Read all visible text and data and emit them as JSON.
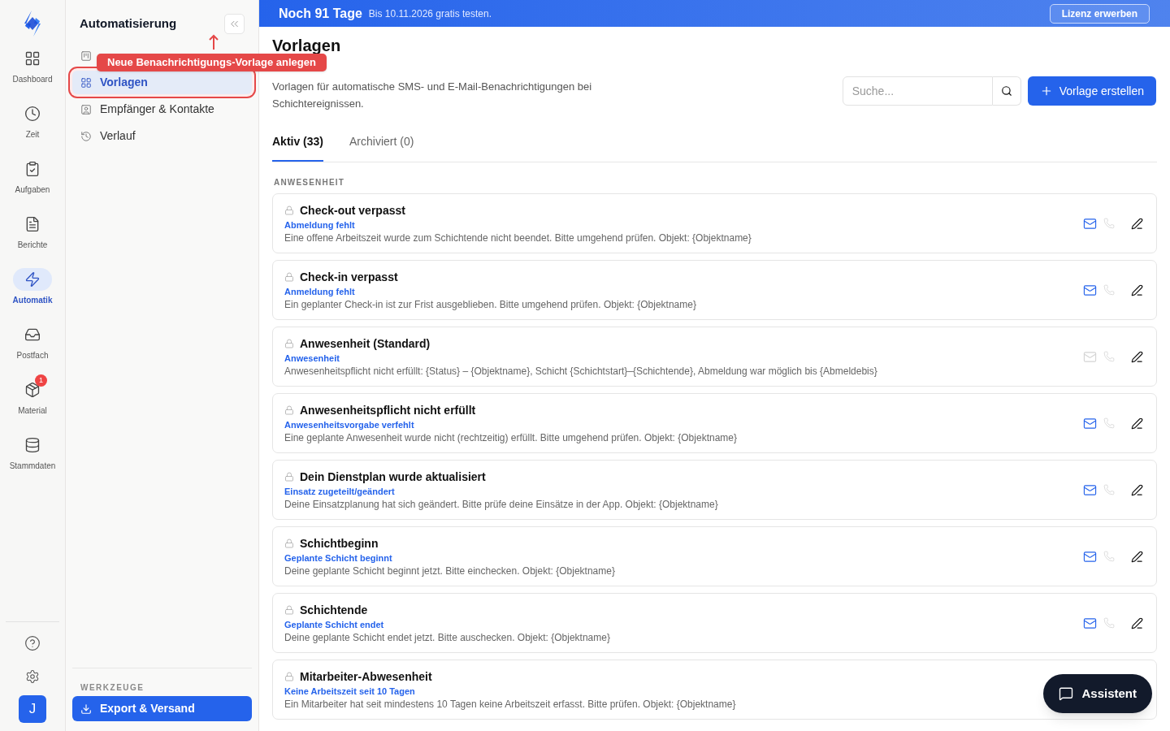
{
  "rail": {
    "items": [
      {
        "label": "Dashboard",
        "selected": false
      },
      {
        "label": "Zeit",
        "selected": false
      },
      {
        "label": "Aufgaben",
        "selected": false
      },
      {
        "label": "Berichte",
        "selected": false
      },
      {
        "label": "Automatik",
        "selected": true
      },
      {
        "label": "Postfach",
        "selected": false
      },
      {
        "label": "Material",
        "selected": false,
        "badge": "1"
      },
      {
        "label": "Stammdaten",
        "selected": false
      }
    ],
    "avatar": "J"
  },
  "sidebar": {
    "title": "Automatisierung",
    "items": [
      {
        "selected": false
      },
      {
        "label": "Vorlagen",
        "selected": true
      },
      {
        "label": "Empfänger & Kontakte",
        "selected": false
      },
      {
        "label": "Verlauf",
        "selected": false
      }
    ],
    "section": "WERKZEUGE",
    "tool_button": "Export & Versand"
  },
  "annotation": {
    "text": "Neue Benachrichtigungs-Vorlage anlegen"
  },
  "banner": {
    "title": "Noch 91 Tage",
    "subtitle": "Bis 10.11.2026 gratis testen.",
    "button": "Lizenz erwerben"
  },
  "page": {
    "title": "Vorlagen",
    "description": "Vorlagen für automatische SMS- und E-Mail-Benachrichtigungen bei Schichtereignissen.",
    "search": {
      "placeholder": "Suche..."
    },
    "create_button": "Vorlage erstellen"
  },
  "tabs": [
    {
      "label": "Aktiv (33)",
      "selected": true
    },
    {
      "label": "Archiviert (0)",
      "selected": false
    }
  ],
  "group": "ANWESENHEIT",
  "templates": [
    {
      "title": "Check-out verpasst",
      "trigger": "Abmeldung fehlt",
      "text": "Eine offene Arbeitszeit wurde zum Schichtende nicht beendet. Bitte umgehend prüfen. Objekt: {Objektname}",
      "email": true
    },
    {
      "title": "Check-in verpasst",
      "trigger": "Anmeldung fehlt",
      "text": "Ein geplanter Check-in ist zur Frist ausgeblieben. Bitte umgehend prüfen. Objekt: {Objektname}",
      "email": true
    },
    {
      "title": "Anwesenheit (Standard)",
      "trigger": "Anwesenheit",
      "text": "Anwesenheitspflicht nicht erfüllt: {Status} – {Objektname}, Schicht {Schichtstart}–{Schichtende}, Abmeldung war möglich bis {Abmeldebis}",
      "email": false
    },
    {
      "title": "Anwesenheitspflicht nicht erfüllt",
      "trigger": "Anwesenheitsvorgabe verfehlt",
      "text": "Eine geplante Anwesenheit wurde nicht (rechtzeitig) erfüllt. Bitte umgehend prüfen. Objekt: {Objektname}",
      "email": true
    },
    {
      "title": "Dein Dienstplan wurde aktualisiert",
      "trigger": "Einsatz zugeteilt/geändert",
      "text": "Deine Einsatzplanung hat sich geändert. Bitte prüfe deine Einsätze in der App. Objekt: {Objektname}",
      "email": true
    },
    {
      "title": "Schichtbeginn",
      "trigger": "Geplante Schicht beginnt",
      "text": "Deine geplante Schicht beginnt jetzt. Bitte einchecken. Objekt: {Objektname}",
      "email": true
    },
    {
      "title": "Schichtende",
      "trigger": "Geplante Schicht endet",
      "text": "Deine geplante Schicht endet jetzt. Bitte auschecken. Objekt: {Objektname}",
      "email": true
    },
    {
      "title": "Mitarbeiter-Abwesenheit",
      "trigger": "Keine Arbeitszeit seit 10 Tagen",
      "text": "Ein Mitarbeiter hat seit mindestens 10 Tagen keine Arbeitszeit erfasst. Bitte prüfen. Objekt: {Objektname}"
    }
  ],
  "assistant_button": "Assistent"
}
